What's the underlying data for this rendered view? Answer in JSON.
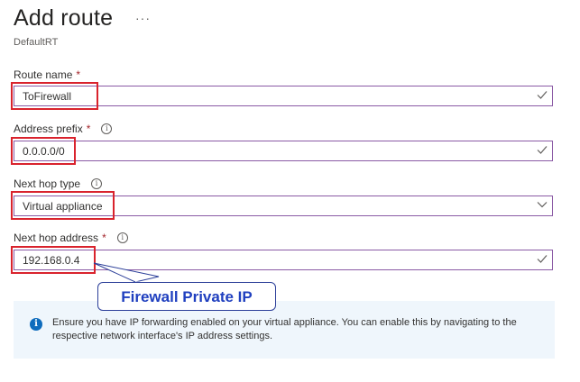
{
  "header": {
    "title": "Add route",
    "more_label": "···",
    "subtitle": "DefaultRT"
  },
  "form": {
    "route_name": {
      "label": "Route name",
      "required_mark": "*",
      "value": "ToFirewall"
    },
    "address_prefix": {
      "label": "Address prefix",
      "required_mark": "*",
      "value": "0.0.0.0/0",
      "info_icon": "i"
    },
    "next_hop_type": {
      "label": "Next hop type",
      "value": "Virtual appliance",
      "info_icon": "i"
    },
    "next_hop_address": {
      "label": "Next hop address",
      "required_mark": "*",
      "value": "192.168.0.4",
      "info_icon": "i"
    }
  },
  "annotation": {
    "text": "Firewall Private IP"
  },
  "info_banner": {
    "icon": "i",
    "text": "Ensure you have IP forwarding enabled on your virtual appliance. You can enable this by navigating to the respective network interface's IP address settings."
  },
  "colors": {
    "accent": "#8a5aa5",
    "highlight": "#d9232d",
    "annotation": "#1f3fbf",
    "info": "#0f6cbd"
  }
}
